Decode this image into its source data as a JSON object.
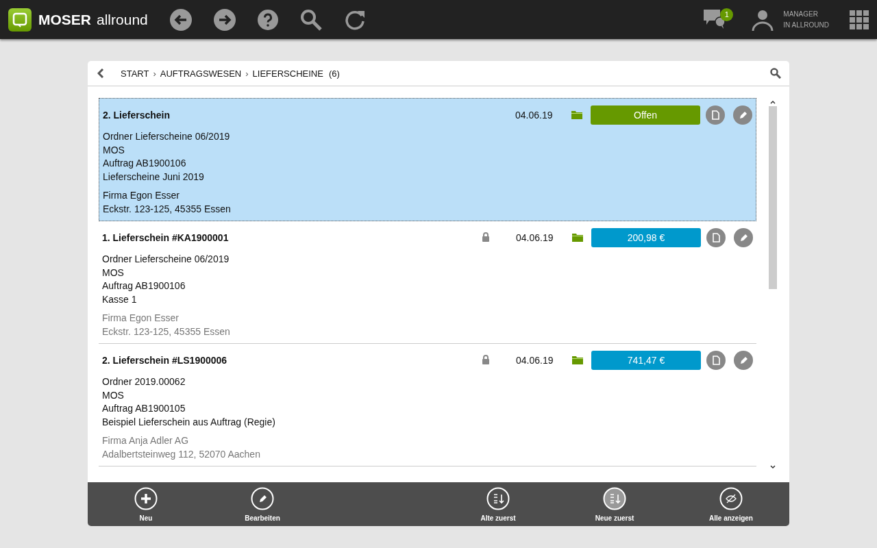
{
  "app": {
    "brand": "MOSER",
    "product": "allround",
    "notifications": "1",
    "user_lines": [
      "MANAGER",
      "IN ALLROUND"
    ]
  },
  "breadcrumb": {
    "items": [
      "START",
      "AUFTRAGSWESEN",
      "LIEFERSCHEINE"
    ],
    "separators": [
      "›",
      "›"
    ],
    "count": "(6)"
  },
  "entries": [
    {
      "title": "2. Lieferschein",
      "locked": false,
      "date": "04.06.19",
      "status": "Offen",
      "color": "#669900",
      "selected": true,
      "details": [
        "Ordner Lieferscheine 06/2019",
        "MOS",
        "Auftrag AB1900106",
        "Lieferscheine Juni 2019"
      ],
      "customer": [
        "Firma Egon Esser",
        "Eckstr. 123-125, 45355 Essen"
      ]
    },
    {
      "title": "1. Lieferschein #KA1900001",
      "locked": true,
      "date": "04.06.19",
      "status": "200,98 €",
      "color": "#0099cc",
      "selected": false,
      "details": [
        "Ordner Lieferscheine 06/2019",
        "MOS",
        "Auftrag AB1900106",
        "Kasse 1"
      ],
      "customer": [
        "Firma Egon Esser",
        "Eckstr. 123-125, 45355 Essen"
      ]
    },
    {
      "title": "2. Lieferschein #LS1900006",
      "locked": true,
      "date": "04.06.19",
      "status": "741,47 €",
      "color": "#0099cc",
      "selected": false,
      "details": [
        "Ordner 2019.00062",
        "MOS",
        "Auftrag AB1900105",
        "Beispiel Lieferschein aus Auftrag (Regie)"
      ],
      "customer": [
        "Firma Anja Adler AG",
        "Adalbertsteinweg 112, 52070 Aachen"
      ]
    }
  ],
  "actions": [
    {
      "label": "Neu",
      "kind": "add",
      "selected": false
    },
    {
      "label": "Bearbeiten",
      "kind": "edit",
      "selected": false
    },
    {
      "label": "Alte zuerst",
      "kind": "sort-asc",
      "selected": false
    },
    {
      "label": "Neue zuerst",
      "kind": "sort-desc",
      "selected": true
    },
    {
      "label": "Alle anzeigen",
      "kind": "hidden",
      "selected": false
    }
  ]
}
